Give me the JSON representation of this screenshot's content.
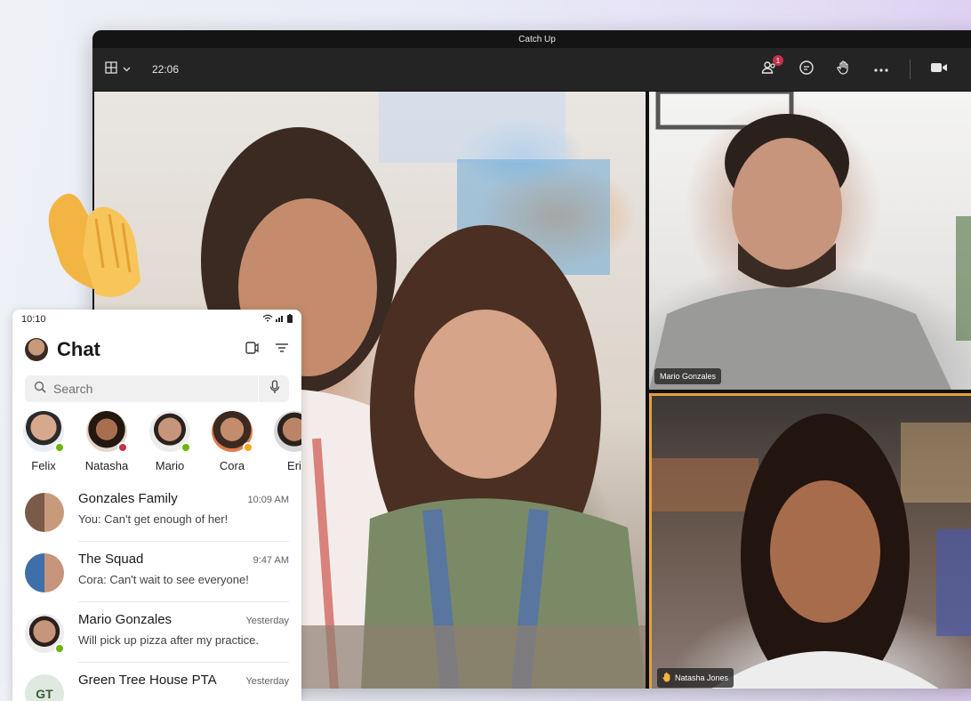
{
  "window": {
    "title": "Catch Up",
    "call_timer": "22:06",
    "participants_badge": "1",
    "icons": [
      "layout-icon",
      "chevron-down-icon",
      "people-icon",
      "chat-icon",
      "raise-hand-icon",
      "more-icon",
      "camera-icon"
    ]
  },
  "tiles": {
    "mario": {
      "name": "Mario Gonzales"
    },
    "natasha": {
      "name": "Natasha Jones",
      "hand_raised": true,
      "active_speaker_color": "#e3a33a"
    }
  },
  "phone": {
    "status_time": "10:10",
    "title": "Chat",
    "search_placeholder": "Search",
    "stories": [
      {
        "name": "Felix",
        "presence": "available",
        "presence_color": "#6bb700"
      },
      {
        "name": "Natasha",
        "presence": "busy",
        "presence_color": "#c4314b"
      },
      {
        "name": "Mario",
        "presence": "available",
        "presence_color": "#6bb700"
      },
      {
        "name": "Cora",
        "presence": "away",
        "presence_color": "#f8a81c"
      },
      {
        "name": "Eri",
        "presence": "none",
        "presence_color": ""
      }
    ],
    "chats": [
      {
        "name": "Gonzales Family",
        "time": "10:09 AM",
        "preview": "You: Can't get enough of her!"
      },
      {
        "name": "The Squad",
        "time": "9:47 AM",
        "preview": "Cora: Can't wait to see everyone!"
      },
      {
        "name": "Mario Gonzales",
        "time": "Yesterday",
        "preview": "Will pick up pizza after my practice."
      },
      {
        "name": "Green Tree House PTA",
        "time": "Yesterday",
        "preview": "",
        "initials": "GT"
      }
    ]
  },
  "colors": {
    "presence_available": "#6bb700",
    "presence_busy": "#c4314b",
    "presence_away": "#f8a81c",
    "badge": "#c4314b"
  }
}
